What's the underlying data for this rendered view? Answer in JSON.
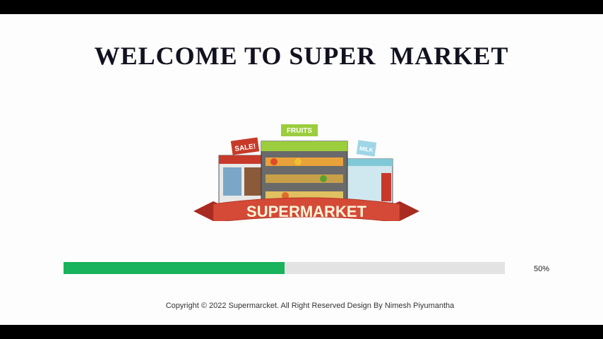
{
  "app": {
    "title": "WELCOME TO SUPER  MARKET"
  },
  "logo": {
    "banner_text": "SUPERMARKET",
    "fruits_sign": "FRUITS",
    "sale_sign": "SALE!",
    "milk_sign": "MILK"
  },
  "progress": {
    "value": 0.5,
    "label": "50%",
    "color": "#18b35c"
  },
  "footer": {
    "copyright": "Copyright © 2022 Supermarcket. All Right Reserved Design By Nimesh Piyumantha"
  }
}
